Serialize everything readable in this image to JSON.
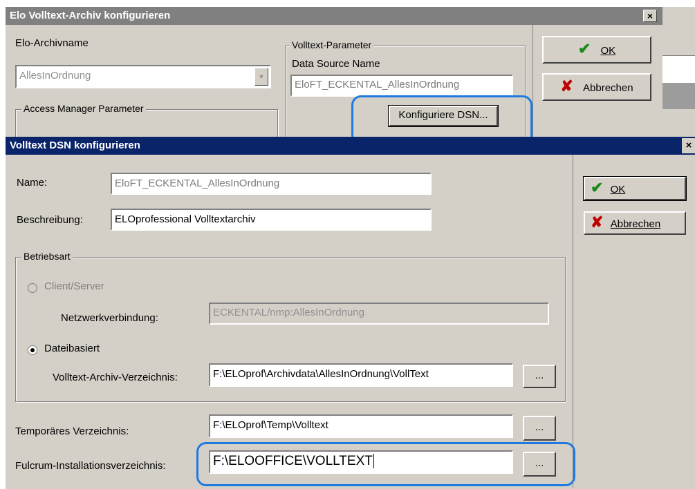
{
  "back_window": {
    "title": "Elo Volltext-Archiv konfigurieren",
    "close_glyph": "×",
    "archivname_label": "Elo-Archivname",
    "archivname_value": "AllesInOrdnung",
    "dropdown_arrow": "▼",
    "access_group_label": "Access Manager Parameter",
    "volltext_group_label": "Volltext-Parameter",
    "dsn_label": "Data Source Name",
    "dsn_value": "EloFT_ECKENTAL_AllesInOrdnung",
    "konfig_button": "Konfiguriere DSN...",
    "ok_button": "OK",
    "cancel_button": "Abbrechen"
  },
  "front_window": {
    "title": "Volltext DSN konfigurieren",
    "close_glyph": "×",
    "name_label": "Name:",
    "name_value": "EloFT_ECKENTAL_AllesInOrdnung",
    "beschreibung_label": "Beschreibung:",
    "beschreibung_value": "ELOprofessional Volltextarchiv",
    "betriebsart_label": "Betriebsart",
    "client_server_label": "Client/Server",
    "netzwerk_label": "Netzwerkverbindung:",
    "netzwerk_value": "ECKENTAL/nmp:AllesInOrdnung",
    "dateibasiert_label": "Dateibasiert",
    "archiv_verz_label": "Volltext-Archiv-Verzeichnis:",
    "archiv_verz_value": "F:\\ELOprof\\Archivdata\\AllesInOrdnung\\VollText",
    "temp_label": "Temporäres Verzeichnis:",
    "temp_value": "F:\\ELOprof\\Temp\\Volltext",
    "fulcrum_label": "Fulcrum-Installationsverzeichnis:",
    "fulcrum_value": "F:\\ELOOFFICE\\VOLLTEXT",
    "browse_label": "...",
    "ok_button": "OK",
    "cancel_button": "Abbrechen"
  },
  "icons": {
    "ok": "check-icon",
    "cancel": "cross-icon",
    "ok_glyph": "✔",
    "cancel_glyph": "✘"
  },
  "colors": {
    "active_title": "#0a246a",
    "inactive_title": "#808080",
    "highlight": "#1f7ae0"
  }
}
